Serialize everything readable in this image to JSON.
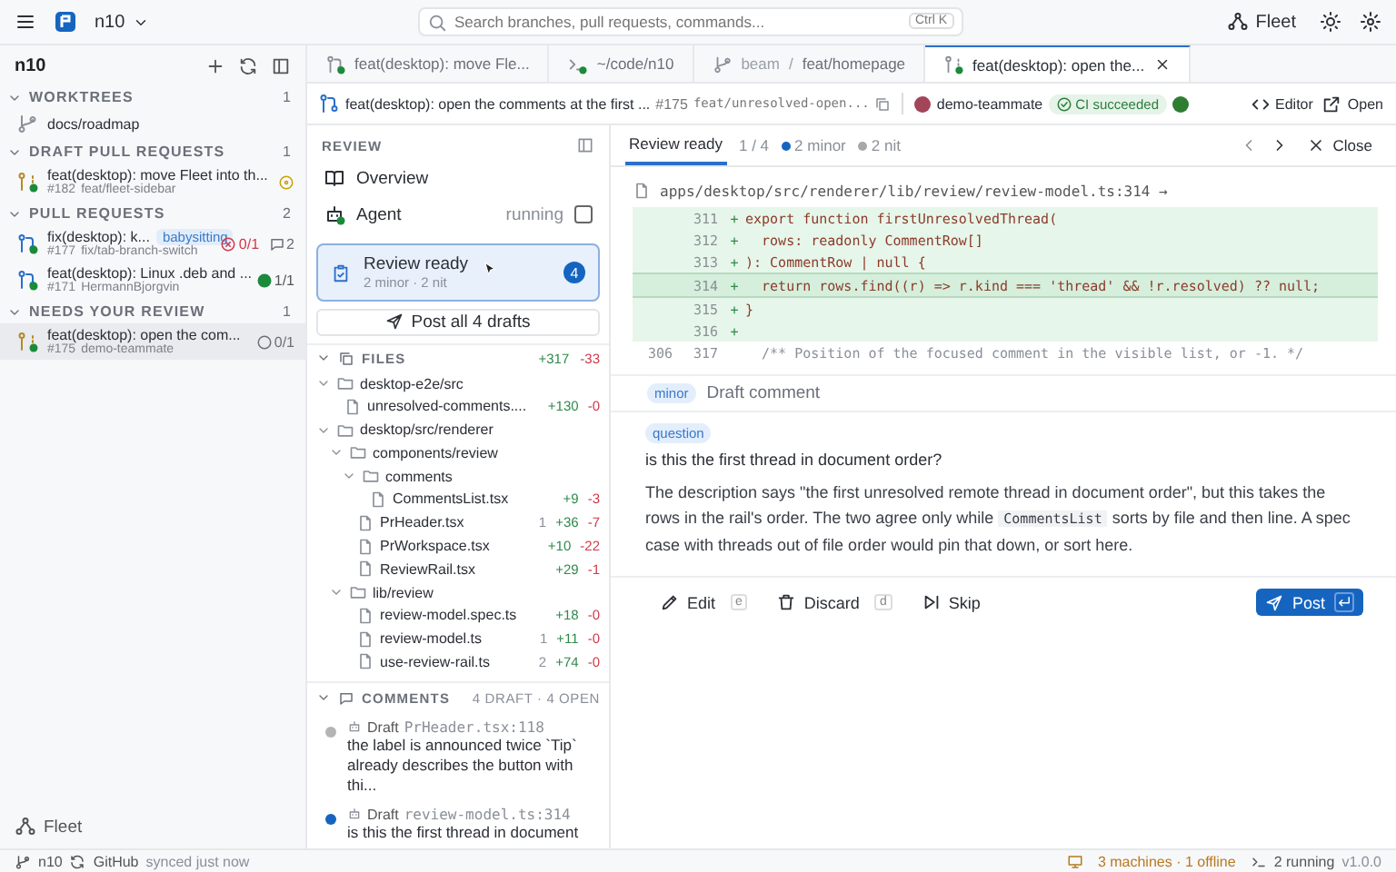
{
  "topbar": {
    "workspace": "n10",
    "search_placeholder": "Search branches, pull requests, commands...",
    "shortcut": "Ctrl K",
    "fleet_label": "Fleet"
  },
  "sidebar": {
    "title": "n10",
    "sections": [
      {
        "title": "WORKTREES",
        "count": "1",
        "expanded": true,
        "items": [
          {
            "kind": "worktree",
            "title": "docs/roadmap",
            "selected": false
          }
        ]
      },
      {
        "title": "DRAFT PULL REQUESTS",
        "count": "1",
        "expanded": true,
        "items": [
          {
            "kind": "draft",
            "title": "feat(desktop): move Fleet into th...",
            "number": "#182",
            "branch": "feat/fleet-sidebar",
            "check": {
              "kind": "pending"
            },
            "selected": false
          }
        ]
      },
      {
        "title": "PULL REQUESTS",
        "count": "2",
        "expanded": true,
        "items": [
          {
            "kind": "pr",
            "title": "fix(desktop): k...",
            "tag": "babysitting",
            "number": "#177",
            "branch": "fix/tab-branch-switch",
            "check": {
              "kind": "failed",
              "text": "0/1"
            },
            "comments": "2",
            "selected": false
          },
          {
            "kind": "pr",
            "title": "feat(desktop): Linux .deb and ...",
            "number": "#171",
            "branch": "HermannBjorgvin",
            "check": {
              "kind": "passed",
              "text": "1/1"
            },
            "selected": false
          }
        ]
      },
      {
        "title": "NEEDS YOUR REVIEW",
        "count": "1",
        "expanded": true,
        "items": [
          {
            "kind": "draft",
            "title": "feat(desktop): open the com...",
            "number": "#175",
            "branch": "demo-teammate",
            "check": {
              "kind": "none",
              "text": "0/1"
            },
            "selected": true
          }
        ]
      }
    ],
    "fleet_label": "Fleet"
  },
  "tabs": [
    {
      "kind": "pr",
      "label": "feat(desktop): move Fle...",
      "selected": false
    },
    {
      "kind": "terminal",
      "label": "~/code/n10",
      "selected": false
    },
    {
      "kind": "branch",
      "repo": "beam",
      "separator": "/",
      "label": "feat/homepage",
      "selected": false
    },
    {
      "kind": "draft",
      "label": "feat(desktop): open the...",
      "selected": true
    }
  ],
  "pr_header": {
    "title": "feat(desktop): open the comments at the first ...",
    "number": "#175",
    "branch": "feat/unresolved-open...",
    "author": "demo-teammate",
    "ci": "CI succeeded",
    "editor": "Editor",
    "open": "Open"
  },
  "review_panel": {
    "title": "REVIEW",
    "nav": [
      {
        "kind": "overview",
        "label": "Overview"
      },
      {
        "kind": "agent",
        "label": "Agent",
        "status": "running",
        "checked": false
      }
    ],
    "ready": {
      "title": "Review ready",
      "summary": "2 minor · 2 nit",
      "count": "4",
      "selected": true
    },
    "post_all": "Post all 4 drafts",
    "files": {
      "title": "FILES",
      "expanded": true,
      "additions": "+317",
      "deletions": "-33",
      "tree": [
        {
          "kind": "folder",
          "name": "desktop-e2e/src",
          "expanded": true,
          "children": [
            {
              "kind": "file",
              "name": "unresolved-comments....",
              "additions": "+130",
              "deletions": "-0"
            }
          ]
        },
        {
          "kind": "folder",
          "name": "desktop/src/renderer",
          "expanded": true,
          "children": [
            {
              "kind": "folder",
              "name": "components/review",
              "expanded": true,
              "children": [
                {
                  "kind": "folder",
                  "name": "comments",
                  "expanded": true,
                  "children": [
                    {
                      "kind": "file",
                      "name": "CommentsList.tsx",
                      "additions": "+9",
                      "deletions": "-3"
                    }
                  ]
                },
                {
                  "kind": "file",
                  "name": "PrHeader.tsx",
                  "comments": "1",
                  "additions": "+36",
                  "deletions": "-7"
                },
                {
                  "kind": "file",
                  "name": "PrWorkspace.tsx",
                  "additions": "+10",
                  "deletions": "-22"
                },
                {
                  "kind": "file",
                  "name": "ReviewRail.tsx",
                  "additions": "+29",
                  "deletions": "-1"
                }
              ]
            },
            {
              "kind": "folder",
              "name": "lib/review",
              "expanded": true,
              "children": [
                {
                  "kind": "file",
                  "name": "review-model.spec.ts",
                  "additions": "+18",
                  "deletions": "-0"
                },
                {
                  "kind": "file",
                  "name": "review-model.ts",
                  "comments": "1",
                  "additions": "+11",
                  "deletions": "-0"
                },
                {
                  "kind": "file",
                  "name": "use-review-rail.ts",
                  "comments": "2",
                  "additions": "+74",
                  "deletions": "-0"
                }
              ]
            }
          ]
        }
      ]
    },
    "comments": {
      "title": "COMMENTS",
      "expanded": true,
      "summary": "4 DRAFT · 4 OPEN",
      "items": [
        {
          "status": "Draft",
          "location": "PrHeader.tsx:118",
          "text": "the label is announced twice `Tip` already describes the button with thi...",
          "color": "#b4b4b4"
        },
        {
          "status": "Draft",
          "location": "review-model.ts:314",
          "text": "is this the first thread in document",
          "color": "#1565c0"
        }
      ]
    }
  },
  "detail": {
    "tabs": [
      {
        "label": "Review ready",
        "selected": true
      }
    ],
    "position": "1 / 4",
    "tags": [
      {
        "label": "2 minor",
        "color": "#1565c0"
      },
      {
        "label": "2 nit",
        "color": "#a8a8a8"
      }
    ],
    "close": "Close",
    "file_path": "apps/desktop/src/renderer/lib/review/review-model.ts:314 →",
    "diff": [
      {
        "kind": "added",
        "new": "311",
        "sign": "+",
        "code": "export function firstUnresolvedThread(",
        "focused": false
      },
      {
        "kind": "added",
        "new": "312",
        "sign": "+",
        "code": "  rows: readonly CommentRow[]",
        "focused": false
      },
      {
        "kind": "added",
        "new": "313",
        "sign": "+",
        "code": "): CommentRow | null {",
        "focused": false
      },
      {
        "kind": "added",
        "new": "314",
        "sign": "+",
        "code": "  return rows.find((r) => r.kind === 'thread' && !r.resolved) ?? null;",
        "focused": true
      },
      {
        "kind": "added",
        "new": "315",
        "sign": "+",
        "code": "}",
        "focused": false
      },
      {
        "kind": "added",
        "new": "316",
        "sign": "+",
        "focused": false
      },
      {
        "kind": "context",
        "old": "306",
        "new": "317",
        "code": "  /** Position of the focused comment in the visible list, or -1. */",
        "focused": false
      }
    ],
    "draft": {
      "severity": "minor",
      "header": "Draft comment",
      "label": "question",
      "title": "is this the first thread in document order?",
      "body": [
        {
          "kind": "text",
          "text": "The description says \"the first unresolved remote thread in document order\", but this takes the rows in the rail's order. The two agree only while "
        },
        {
          "kind": "code",
          "text": "CommentsList"
        },
        {
          "kind": "text",
          "text": " sorts by file and then line. A spec case with threads out of file order would pin that down, or sort here."
        }
      ],
      "actions": [
        {
          "kind": "edit",
          "label": "Edit",
          "key": "e"
        },
        {
          "kind": "discard",
          "label": "Discard",
          "key": "d"
        },
        {
          "kind": "skip",
          "label": "Skip"
        }
      ],
      "post": "Post"
    }
  },
  "status_bar": {
    "branch": "n10",
    "provider": "GitHub",
    "sync": "synced just now",
    "machines": "3 machines · 1 offline",
    "running": "2 running",
    "version": "v1.0.0"
  }
}
